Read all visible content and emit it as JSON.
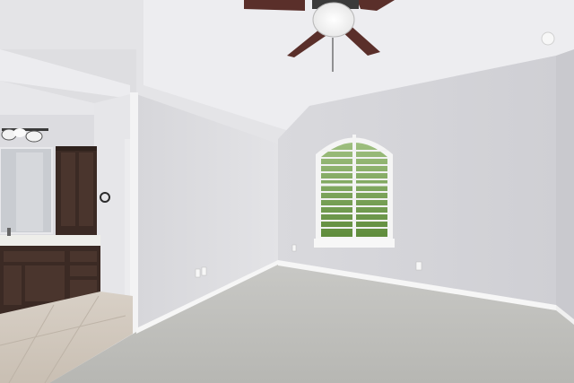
{
  "scene": {
    "kind": "photo-interior-bedroom",
    "colors": {
      "wall_light": "#e6e6e8",
      "wall_shadow": "#cfcfd3",
      "ceiling": "#ececee",
      "carpet": "#bdbdba",
      "tile": "#cfc6bb",
      "cabinet": "#3b2a24",
      "countertop": "#eeeeea",
      "window_greenery": "#6f9a4a",
      "fan_blade": "#5a2f2a",
      "trim": "#f6f6f6"
    },
    "objects": [
      "ceiling-fan",
      "plantation-shutter-window",
      "bathroom-vanity",
      "linen-cabinet",
      "wall-sconce",
      "mirror",
      "carpet-floor",
      "tile-floor",
      "baseboard",
      "electrical-outlet"
    ]
  }
}
